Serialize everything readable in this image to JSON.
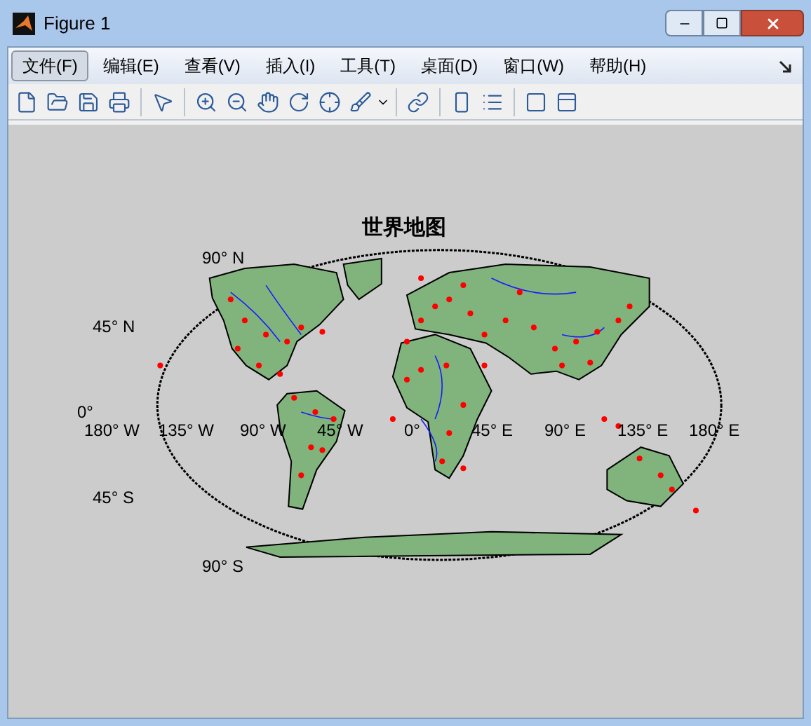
{
  "window": {
    "title": "Figure 1"
  },
  "menu": [
    {
      "label": "文件(F)",
      "selected": true
    },
    {
      "label": "编辑(E)",
      "selected": false
    },
    {
      "label": "查看(V)",
      "selected": false
    },
    {
      "label": "插入(I)",
      "selected": false
    },
    {
      "label": "工具(T)",
      "selected": false
    },
    {
      "label": "桌面(D)",
      "selected": false
    },
    {
      "label": "窗口(W)",
      "selected": false
    },
    {
      "label": "帮助(H)",
      "selected": false
    }
  ],
  "plot": {
    "title": "世界地图",
    "lat_labels": [
      {
        "text": "90° N",
        "kind": "top"
      },
      {
        "text": "45° N",
        "kind": "north"
      },
      {
        "text": "0°",
        "kind": "equator"
      },
      {
        "text": "45° S",
        "kind": "south"
      },
      {
        "text": "90° S",
        "kind": "bottom"
      }
    ],
    "lon_labels": [
      "180° W",
      "135° W",
      "90° W",
      "45° W",
      "0°",
      "45° E",
      "90° E",
      "135° E",
      "180° E"
    ]
  }
}
